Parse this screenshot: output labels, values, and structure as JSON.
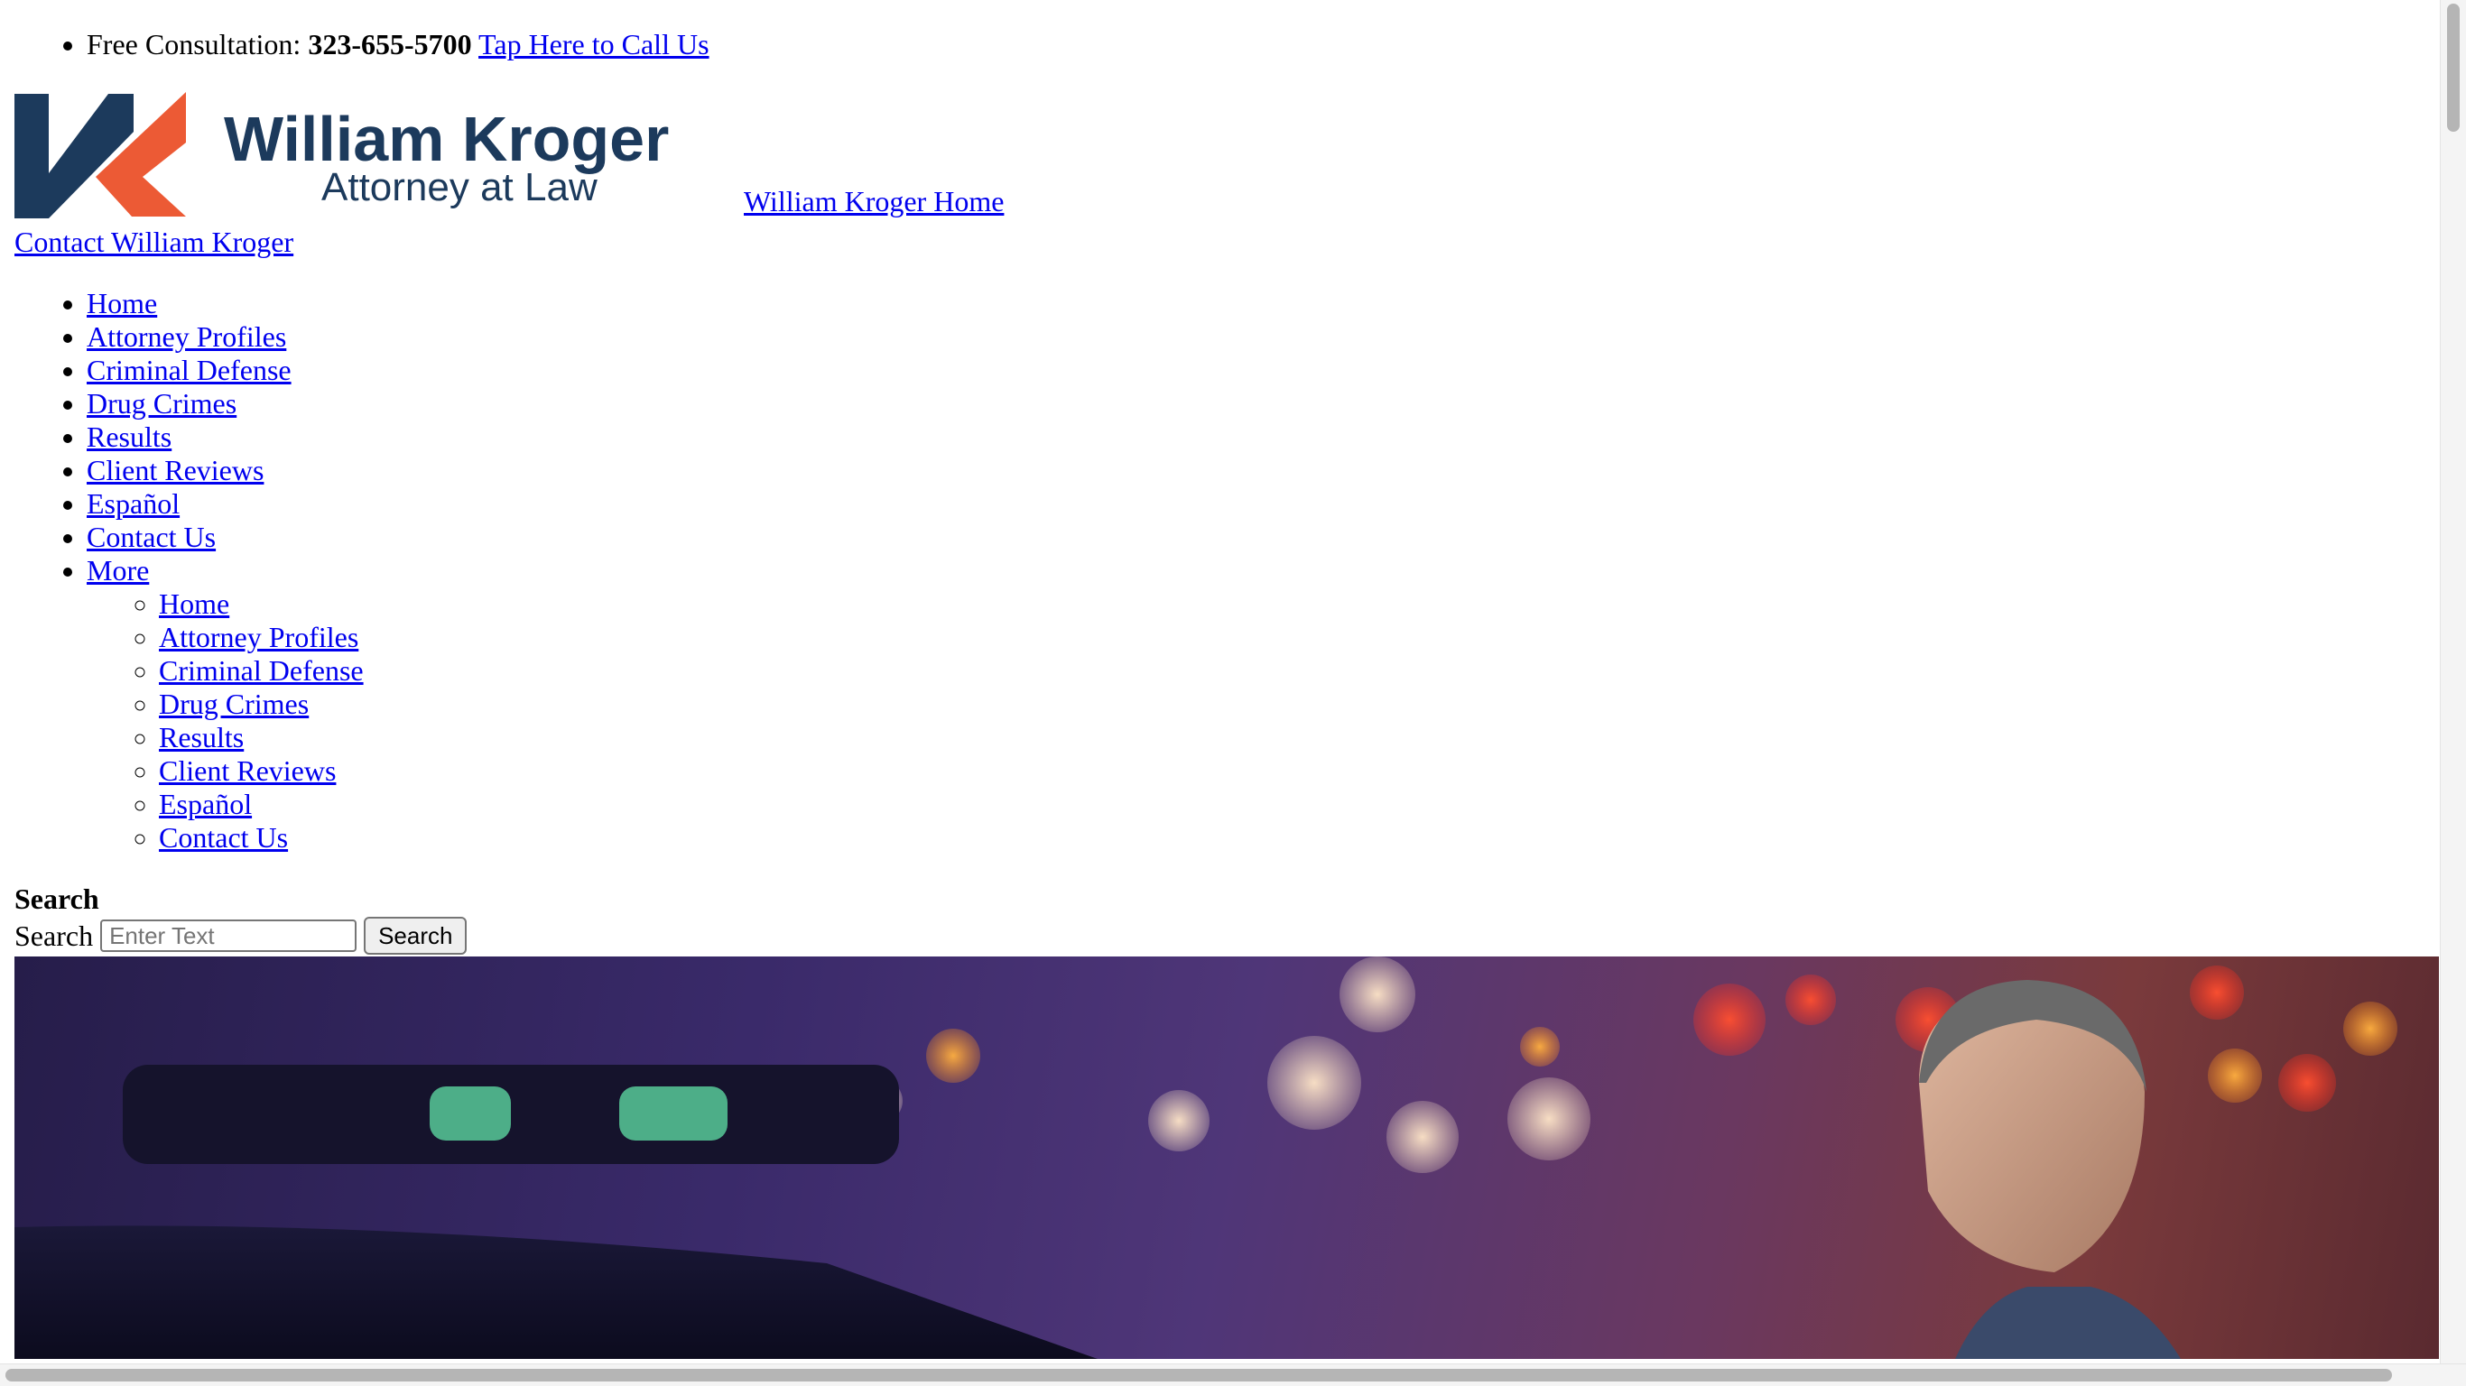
{
  "top_bar": {
    "consultation_label": "Free Consultation:",
    "phone": "323-655-5700",
    "call_link": "Tap Here to Call Us"
  },
  "header": {
    "logo_name": "William Kroger",
    "logo_tagline": "Attorney at Law",
    "home_link": "William Kroger Home",
    "contact_link": "Contact William Kroger",
    "logo_colors": {
      "navy": "#1c3a5c",
      "orange": "#ec5a35"
    }
  },
  "nav": {
    "items": [
      {
        "label": "Home"
      },
      {
        "label": "Attorney Profiles"
      },
      {
        "label": "Criminal Defense"
      },
      {
        "label": "Drug Crimes"
      },
      {
        "label": "Results"
      },
      {
        "label": "Client Reviews"
      },
      {
        "label": "Español"
      },
      {
        "label": "Contact Us"
      },
      {
        "label": "More"
      }
    ],
    "more_items": [
      {
        "label": "Home"
      },
      {
        "label": "Attorney Profiles"
      },
      {
        "label": "Criminal Defense"
      },
      {
        "label": "Drug Crimes"
      },
      {
        "label": "Results"
      },
      {
        "label": "Client Reviews"
      },
      {
        "label": "Español"
      },
      {
        "label": "Contact Us"
      }
    ]
  },
  "search": {
    "heading": "Search",
    "label": "Search",
    "placeholder": "Enter Text",
    "button_label": "Search"
  },
  "colors": {
    "link": "#0000ee"
  }
}
